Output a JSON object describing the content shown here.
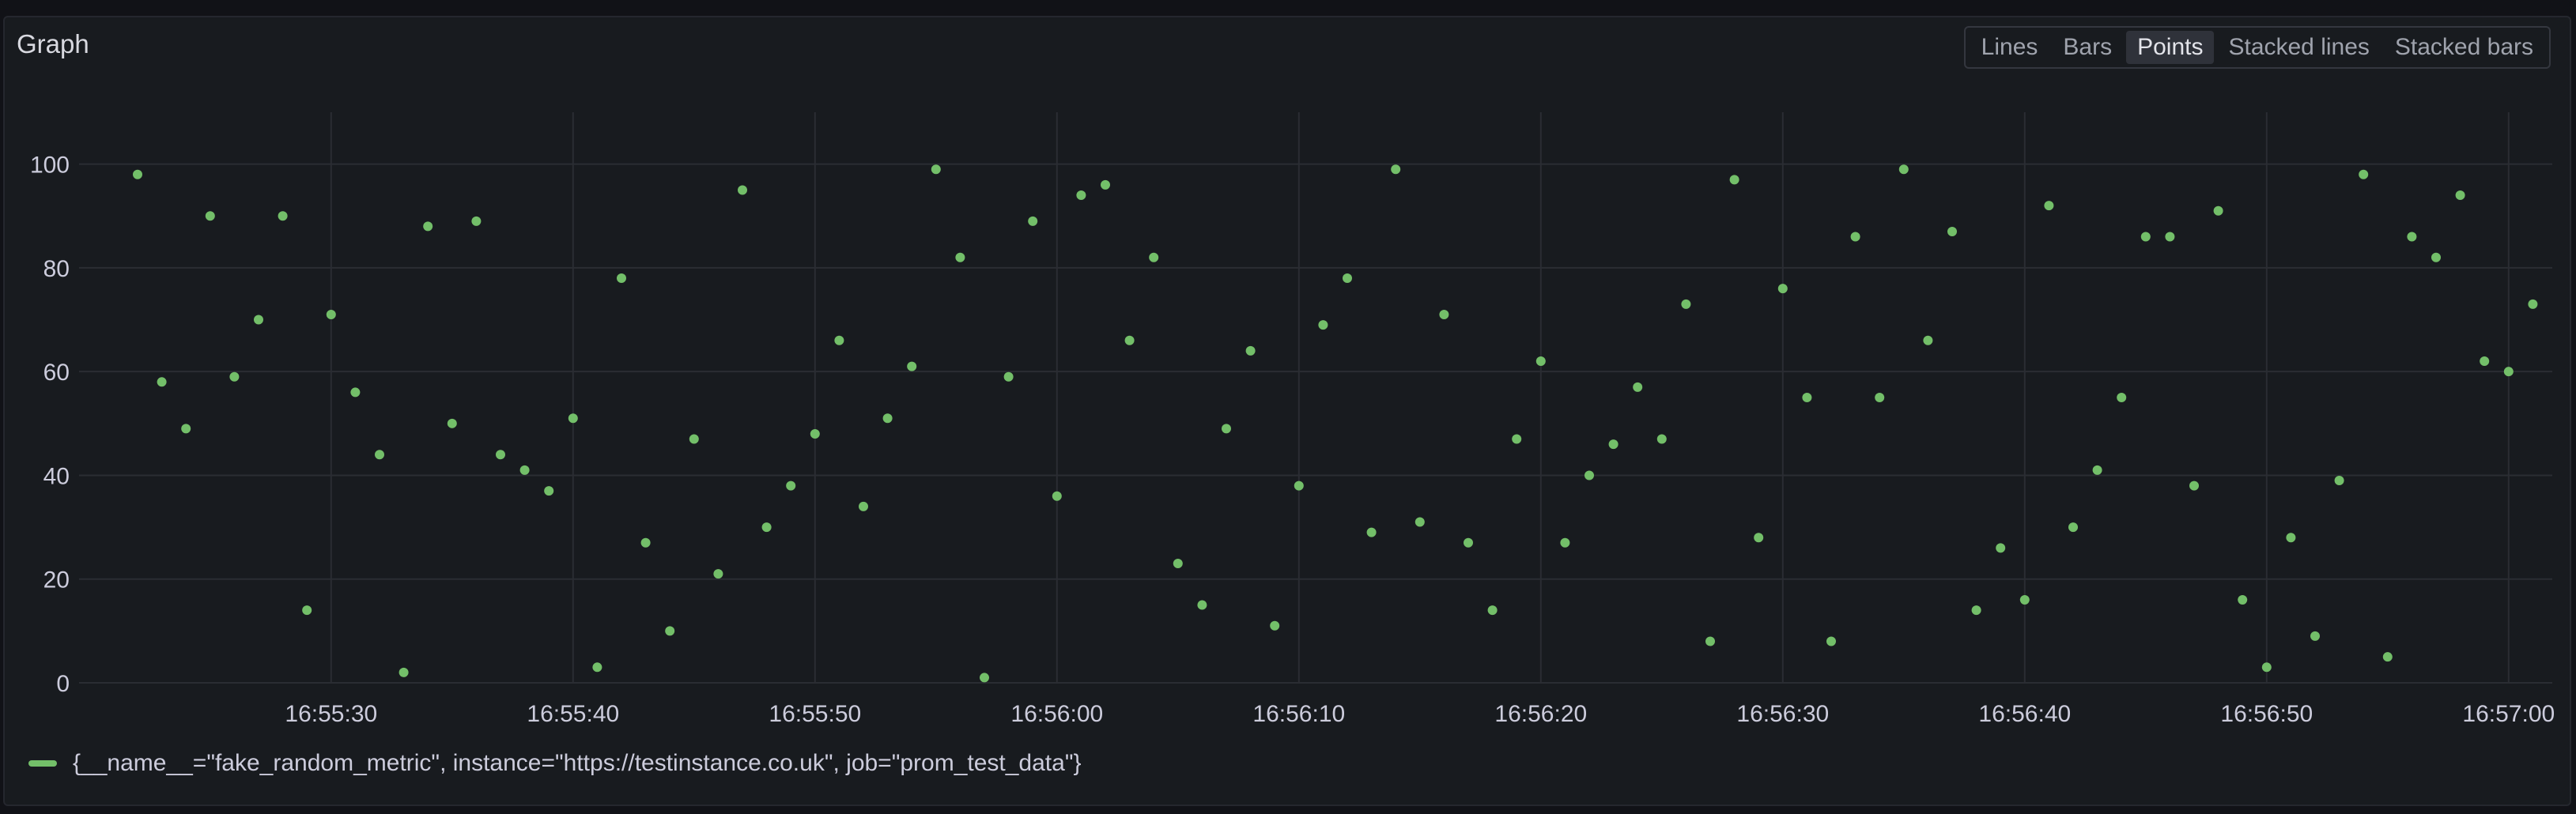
{
  "panel": {
    "title": "Graph"
  },
  "view_modes": [
    {
      "label": "Lines",
      "active": false
    },
    {
      "label": "Bars",
      "active": false
    },
    {
      "label": "Points",
      "active": true
    },
    {
      "label": "Stacked lines",
      "active": false
    },
    {
      "label": "Stacked bars",
      "active": false
    }
  ],
  "colors": {
    "series": "#73bf69",
    "grid": "#2a2d33",
    "panel_bg": "#181b1f"
  },
  "chart_data": {
    "type": "scatter",
    "title": "Graph",
    "xlabel": "",
    "ylabel": "",
    "grid": true,
    "legend_placement": "bottom-left",
    "x_ticks": [
      "16:55:30",
      "16:55:40",
      "16:55:50",
      "16:56:00",
      "16:56:10",
      "16:56:20",
      "16:56:30",
      "16:56:40",
      "16:56:50",
      "16:57:00"
    ],
    "y_ticks": [
      0,
      20,
      40,
      60,
      80,
      100
    ],
    "ylim": [
      0,
      110
    ],
    "x_start": "16:55:22",
    "x_step_seconds": 1,
    "series": [
      {
        "name": "{__name__=\"fake_random_metric\", instance=\"https://testinstance.co.uk\", job=\"prom_test_data\"}",
        "values": [
          98,
          58,
          49,
          90,
          59,
          70,
          90,
          14,
          71,
          56,
          44,
          2,
          88,
          50,
          89,
          44,
          41,
          37,
          51,
          3,
          78,
          27,
          10,
          47,
          21,
          95,
          30,
          38,
          48,
          66,
          34,
          51,
          61,
          99,
          82,
          1,
          59,
          89,
          36,
          94,
          96,
          66,
          82,
          23,
          15,
          49,
          64,
          11,
          38,
          69,
          78,
          29,
          99,
          31,
          71,
          27,
          14,
          47,
          62,
          27,
          40,
          46,
          57,
          47,
          73,
          8,
          97,
          28,
          76,
          55,
          8,
          86,
          55,
          99,
          66,
          87,
          14,
          26,
          16,
          92,
          30,
          41,
          55,
          86,
          86,
          38,
          91,
          16,
          3,
          28,
          9,
          39,
          98,
          5,
          86,
          82,
          94,
          62,
          60,
          73
        ]
      }
    ]
  }
}
